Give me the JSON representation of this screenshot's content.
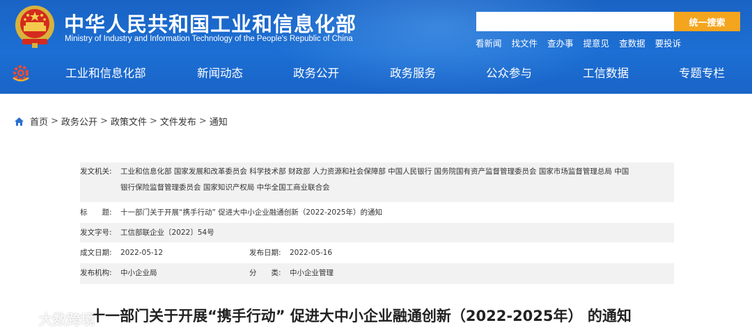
{
  "header": {
    "title_cn": "中华人民共和国工业和信息化部",
    "title_en": "Ministry of Industry and Information Technology of the People's Republic of China",
    "search_placeholder": "",
    "search_button": "统一搜索",
    "quick_links": [
      "看新闻",
      "找文件",
      "查办事",
      "提意见",
      "查数据",
      "要投诉"
    ],
    "nav": [
      "工业和信息化部",
      "新闻动态",
      "政务公开",
      "政务服务",
      "公众参与",
      "工信数据",
      "专题专栏"
    ],
    "colors": {
      "header_bg": "#1c6fd4",
      "search_button": "#f4a51e"
    }
  },
  "breadcrumb": [
    "首页",
    "政务公开",
    "政策文件",
    "文件发布",
    "通知"
  ],
  "info": {
    "issuer_label": "发文机关:",
    "issuer_line1": "工业和信息化部 国家发展和改革委员会 科学技术部 财政部 人力资源和社会保障部 中国人民银行 国务院国有资产监督管理委员会 国家市场监督管理总局 中国",
    "issuer_line2": "银行保险监督管理委员会 国家知识产权局 中华全国工商业联合会",
    "title_label": "标　　题:",
    "title_value": "十一部门关于开展“携手行动” 促进大中小企业融通创新（2022-2025年）的通知",
    "docno_label": "发文字号:",
    "docno_value": "工信部联企业〔2022〕54号",
    "created_label": "成文日期:",
    "created_value": "2022-05-12",
    "published_label": "发布日期:",
    "published_value": "2022-05-16",
    "org_label": "发布机构:",
    "org_value": "中小企业局",
    "category_label": "分　　类:",
    "category_value": "中小企业管理"
  },
  "doc_title": "十一部门关于开展“携手行动” 促进大中小企业融通创新（2022-2025年） 的通知",
  "watermark": "大数跨境"
}
